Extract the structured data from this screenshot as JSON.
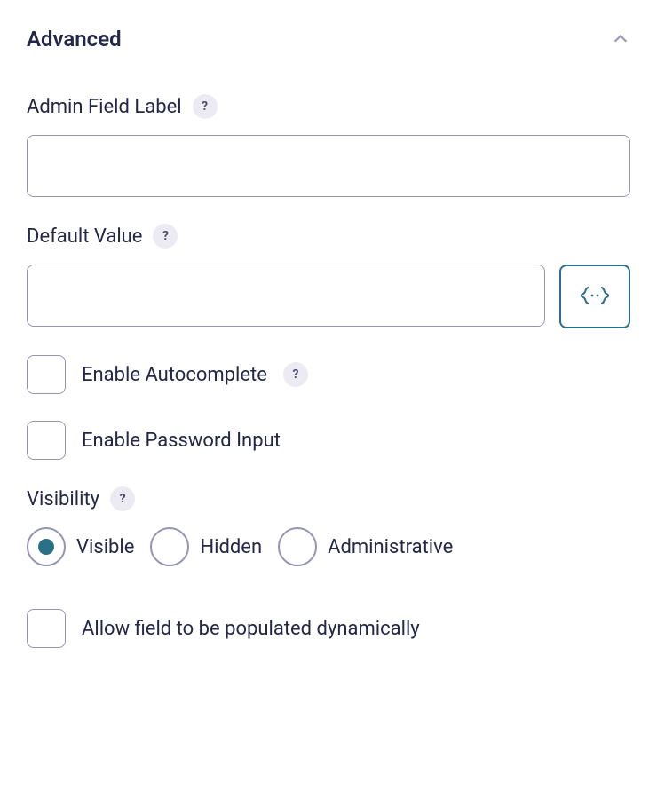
{
  "section": {
    "title": "Advanced"
  },
  "fields": {
    "adminFieldLabel": {
      "label": "Admin Field Label",
      "value": ""
    },
    "defaultValue": {
      "label": "Default Value",
      "value": ""
    },
    "enableAutocomplete": {
      "label": "Enable Autocomplete",
      "checked": false
    },
    "enablePasswordInput": {
      "label": "Enable Password Input",
      "checked": false
    },
    "visibility": {
      "label": "Visibility",
      "selected": "visible",
      "options": {
        "visible": "Visible",
        "hidden": "Hidden",
        "administrative": "Administrative"
      }
    },
    "allowDynamicPopulation": {
      "label": "Allow field to be populated dynamically",
      "checked": false
    }
  },
  "help": "?"
}
